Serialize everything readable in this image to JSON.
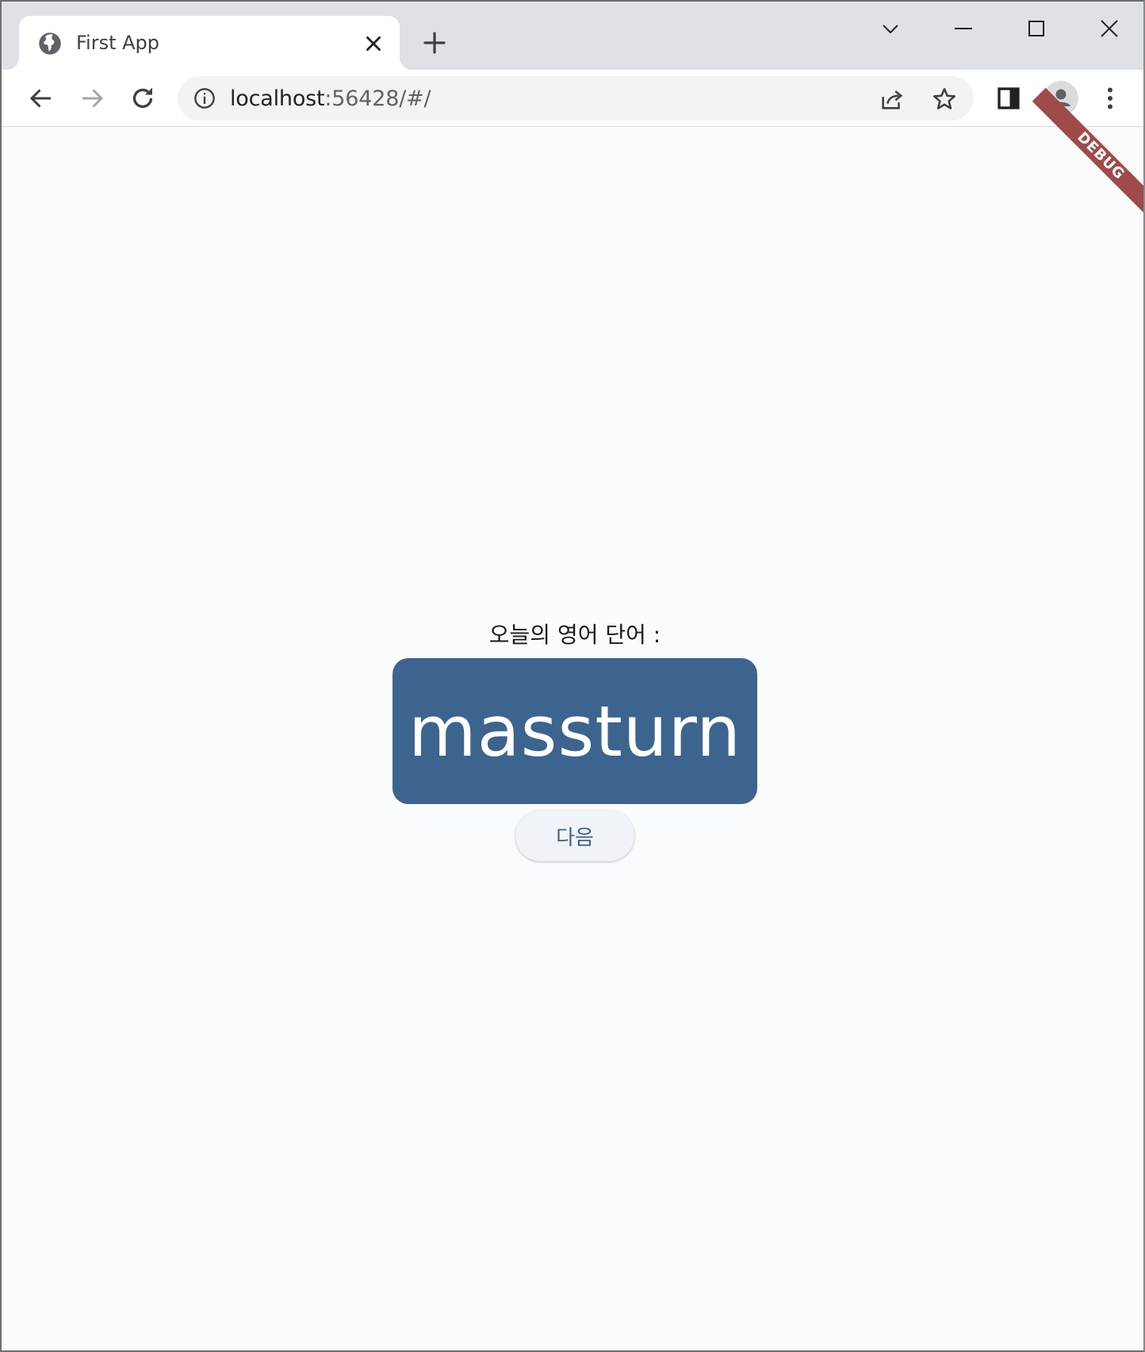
{
  "browser": {
    "tab": {
      "title": "First App"
    },
    "url": {
      "host": "localhost",
      "rest": ":56428/#/"
    }
  },
  "app": {
    "debug_banner": "DEBUG",
    "prompt": "오늘의 영어 단어 :",
    "word": "massturn",
    "next_label": "다음"
  },
  "colors": {
    "card_bg": "#3c648e",
    "debug_banner": "#a04a4a"
  }
}
